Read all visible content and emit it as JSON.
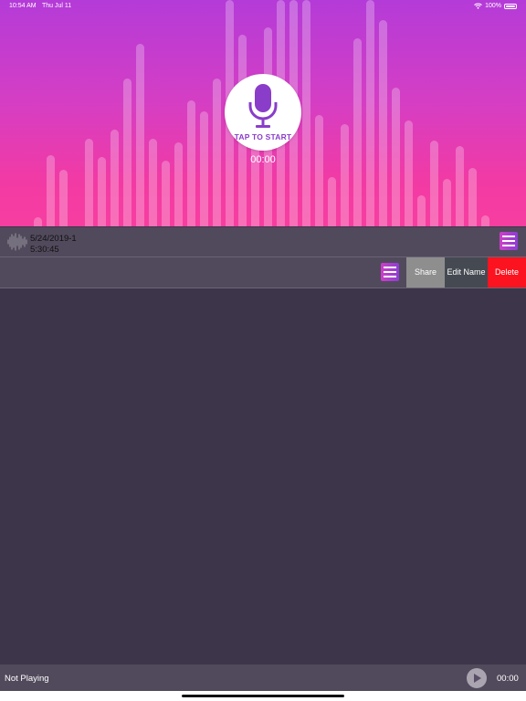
{
  "status_bar": {
    "time": "10:54 AM",
    "date": "Thu Jul 11",
    "battery": "100%"
  },
  "recorder": {
    "button_label": "TAP TO START",
    "timer": "00:00"
  },
  "recordings": [
    {
      "name": "5/24/2019-1",
      "time": "5:30:45"
    }
  ],
  "swipe_actions": {
    "share": "Share",
    "edit_name": "Edit Name",
    "delete": "Delete"
  },
  "player": {
    "status": "Not Playing",
    "time": "00:00"
  },
  "colors": {
    "gradient_top": "#b43bd8",
    "gradient_bottom": "#f73ea0",
    "list_background": "#3d3549",
    "row_background": "#514a5c",
    "share": "#8e8e8e",
    "edit": "#454a52",
    "delete": "#fb1320",
    "mic_purple": "#8a3dc9"
  },
  "icons": {
    "mic": "microphone-icon",
    "waveform": "waveform-icon",
    "menu": "menu-icon",
    "play": "play-icon",
    "wifi": "wifi-icon",
    "battery": "battery-icon"
  }
}
